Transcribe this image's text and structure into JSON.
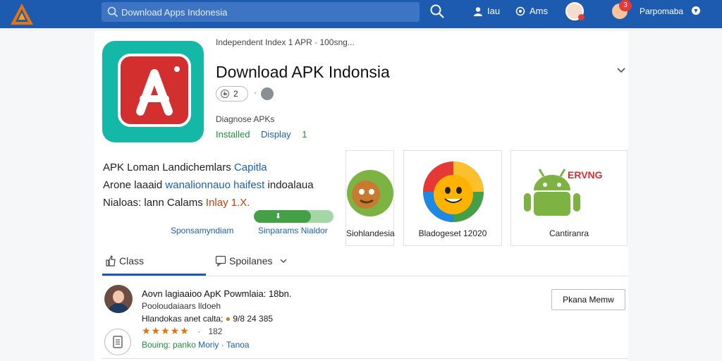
{
  "header": {
    "search_value": "Download Apps Indonesia",
    "nav_item_1": "Iau",
    "nav_item_2": "Ams",
    "notification_count": "3",
    "user_name": "Parpomaba",
    "brand_color": "#1d5bb0"
  },
  "app": {
    "top_line": "Independent Index 1 APR · 100sng...",
    "title": "Download APK Indonsia",
    "rating": "2",
    "rating_separator": "·",
    "subtitle": "Diagnose APKs",
    "meta_1": "Installed",
    "meta_2": "Display",
    "meta_3": "1",
    "icon_name": "apk-app-icon"
  },
  "description": {
    "line_1a": "APK Loman Landichemlars",
    "line_1b": "Capitla",
    "line_2a": "Arone laaaid",
    "line_2b": "wanalionnauo",
    "line_2c": "haifest",
    "line_2d": "indoalaua",
    "line_3a": "Nialoas: lann Calams",
    "line_3b": "Inlay",
    "line_3c": "1.X.",
    "progress": 0.72,
    "link_1": "Sponsamyndiam",
    "link_2": "Sinparams Nialdor"
  },
  "screenshots": [
    {
      "caption": "Siohlandesia"
    },
    {
      "caption": "Bladogeset 12020"
    },
    {
      "caption": "Cantiranra",
      "tag": "ERVNG"
    }
  ],
  "tabs": {
    "tab_1": "Class",
    "tab_2": "Spoilanes"
  },
  "review": {
    "name": "Aovn lagiaaioo ApK Powmlaia: 18bn.",
    "sub": "Pooloudaiaars lldoeh",
    "line": "Hlandokas anet calta;",
    "line_extra": "9/8 24 385",
    "stars": "★★★★★",
    "star_count": "182",
    "foot_1": "Bouing:",
    "foot_2": "panko",
    "foot_3": "Moriy",
    "foot_4": "Tanoa",
    "button": "Pkana Memw",
    "rating_value": 5
  }
}
